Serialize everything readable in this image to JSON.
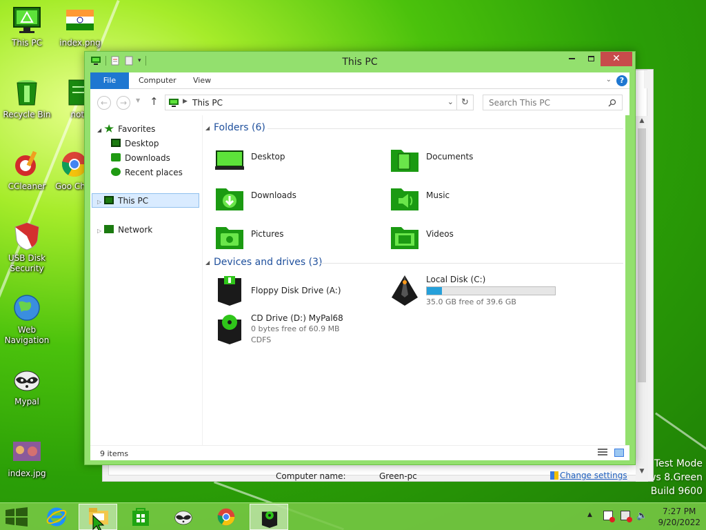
{
  "desktop": {
    "icons": [
      {
        "label": "This PC"
      },
      {
        "label": "index.png"
      },
      {
        "label": "Recycle Bin"
      },
      {
        "label": "note"
      },
      {
        "label": "CCleaner"
      },
      {
        "label": "Goo Chro"
      },
      {
        "label": "USB Disk Security"
      },
      {
        "label": "Web Navigation"
      },
      {
        "label": "Mypal"
      },
      {
        "label": "index.jpg"
      }
    ],
    "watermark": {
      "line1": "Test Mode",
      "line2": "ws 8.Green",
      "line3": "Build 9600"
    }
  },
  "back_window": {
    "computer_name_label": "Computer name:",
    "computer_name_value": "Green-pc",
    "change_settings": "Change settings"
  },
  "explorer": {
    "title": "This PC",
    "ribbon": {
      "tabs": [
        "File",
        "Computer",
        "View"
      ]
    },
    "address": {
      "path": "This PC"
    },
    "search": {
      "placeholder": "Search This PC"
    },
    "nav": {
      "favorites": "Favorites",
      "desktop": "Desktop",
      "downloads": "Downloads",
      "recent": "Recent places",
      "this_pc": "This PC",
      "network": "Network"
    },
    "folders_header": "Folders (6)",
    "folders": [
      "Desktop",
      "Documents",
      "Downloads",
      "Music",
      "Pictures",
      "Videos"
    ],
    "devices_header": "Devices and drives (3)",
    "drives": {
      "floppy": {
        "name": "Floppy Disk Drive (A:)"
      },
      "local": {
        "name": "Local Disk (C:)",
        "free": "35.0 GB free of 39.6 GB",
        "used_fraction": 0.116
      },
      "cd": {
        "name": "CD Drive (D:) MyPal68",
        "free": "0 bytes free of 60.9 MB",
        "fs": "CDFS"
      }
    },
    "status": {
      "items": "9 items"
    }
  },
  "taskbar": {
    "time": "7:27 PM",
    "date": "9/20/2022"
  },
  "colors": {
    "accent": "#1e77d1",
    "frame": "#93e06e",
    "progress": "#26a0da"
  }
}
